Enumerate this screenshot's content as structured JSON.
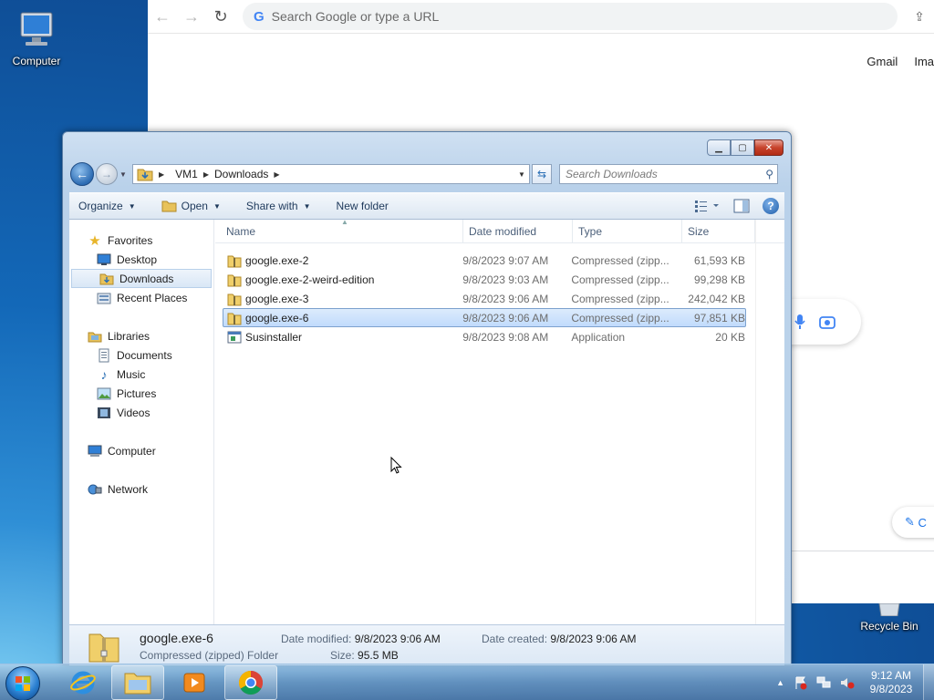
{
  "desktop": {
    "icons": [
      {
        "label": "Computer",
        "icon": "computer-icon"
      },
      {
        "label": "Recycle Bin",
        "icon": "recycle-bin-icon"
      }
    ]
  },
  "chrome": {
    "omnibox_placeholder": "Search Google or type a URL",
    "top_links": [
      "Gmail",
      "Ima"
    ],
    "customize_label": "C"
  },
  "explorer": {
    "address": [
      "VM1",
      "Downloads"
    ],
    "search_placeholder": "Search Downloads",
    "toolbar": {
      "organize": "Organize",
      "open": "Open",
      "share_with": "Share with",
      "new_folder": "New folder"
    },
    "nav": {
      "favorites": "Favorites",
      "desktop": "Desktop",
      "downloads": "Downloads",
      "recent_places": "Recent Places",
      "libraries": "Libraries",
      "documents": "Documents",
      "music": "Music",
      "pictures": "Pictures",
      "videos": "Videos",
      "computer": "Computer",
      "network": "Network"
    },
    "columns": {
      "name": "Name",
      "date": "Date modified",
      "type": "Type",
      "size": "Size"
    },
    "files": [
      {
        "name": "google.exe-2",
        "date": "9/8/2023 9:07 AM",
        "type": "Compressed (zipp...",
        "size": "61,593 KB",
        "icon": "zip-folder-icon"
      },
      {
        "name": "google.exe-2-weird-edition",
        "date": "9/8/2023 9:03 AM",
        "type": "Compressed (zipp...",
        "size": "99,298 KB",
        "icon": "zip-folder-icon"
      },
      {
        "name": "google.exe-3",
        "date": "9/8/2023 9:06 AM",
        "type": "Compressed (zipp...",
        "size": "242,042 KB",
        "icon": "zip-folder-icon"
      },
      {
        "name": "google.exe-6",
        "date": "9/8/2023 9:06 AM",
        "type": "Compressed (zipp...",
        "size": "97,851 KB",
        "icon": "zip-folder-icon"
      },
      {
        "name": "Susinstaller",
        "date": "9/8/2023 9:08 AM",
        "type": "Application",
        "size": "20 KB",
        "icon": "application-icon"
      }
    ],
    "selected_index": 3,
    "details": {
      "name": "google.exe-6",
      "type": "Compressed (zipped) Folder",
      "date_modified_label": "Date modified:",
      "date_modified": "9/8/2023 9:06 AM",
      "date_created_label": "Date created:",
      "date_created": "9/8/2023 9:06 AM",
      "size_label": "Size:",
      "size": "95.5 MB"
    }
  },
  "taskbar": {
    "time": "9:12 AM",
    "date": "9/8/2023"
  },
  "colors": {
    "selection": "#c1dbfc",
    "accent": "#1e395b"
  }
}
